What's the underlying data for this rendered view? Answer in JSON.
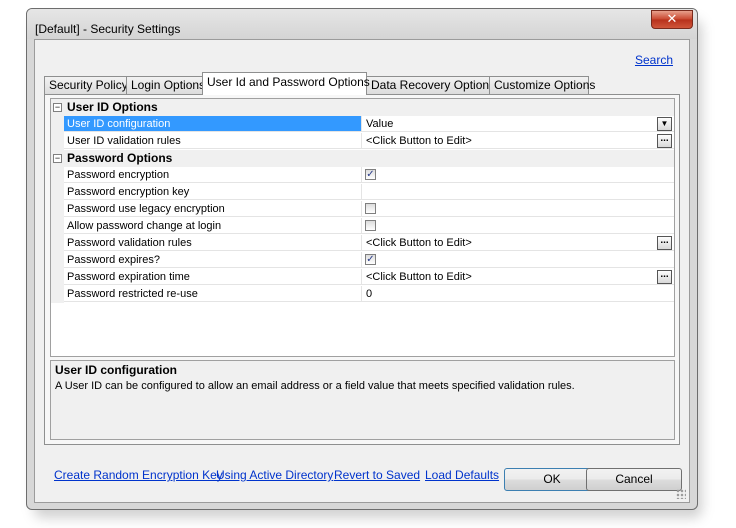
{
  "window": {
    "title": "[Default] - Security Settings",
    "close_label": "✕"
  },
  "search_link": "Search",
  "tabs": [
    {
      "label": "Security Policy",
      "active": false
    },
    {
      "label": "Login Options",
      "active": false
    },
    {
      "label": "User Id and Password Options",
      "active": true
    },
    {
      "label": "Data Recovery Options",
      "active": false
    },
    {
      "label": "Customize Options",
      "active": false
    }
  ],
  "grid": {
    "categories": [
      {
        "label": "User ID Options",
        "expander": "−",
        "rows": [
          {
            "name": "User ID configuration",
            "value": "Value",
            "editor": "dropdown",
            "selected": true
          },
          {
            "name": "User ID validation rules",
            "value": "<Click Button to Edit>",
            "editor": "ellipsis"
          }
        ]
      },
      {
        "label": "Password Options",
        "expander": "−",
        "rows": [
          {
            "name": "Password encryption",
            "checked": true,
            "editor": "checkbox"
          },
          {
            "name": "Password encryption key",
            "value": "",
            "editor": "none"
          },
          {
            "name": "Password use legacy encryption",
            "checked": false,
            "editor": "checkbox"
          },
          {
            "name": "Allow password change at login",
            "checked": false,
            "editor": "checkbox"
          },
          {
            "name": "Password validation rules",
            "value": "<Click Button to Edit>",
            "editor": "ellipsis"
          },
          {
            "name": "Password expires?",
            "checked": true,
            "editor": "checkbox"
          },
          {
            "name": "Password expiration time",
            "value": "<Click Button to Edit>",
            "editor": "ellipsis"
          },
          {
            "name": "Password restricted re-use",
            "value": "0",
            "editor": "none"
          }
        ]
      }
    ],
    "ellipsis_label": "...",
    "dropdown_label": "▼",
    "check_mark": "✓"
  },
  "description": {
    "title": "User ID configuration",
    "text": "A User ID can be configured to allow an email address or a field value that meets specified validation rules."
  },
  "footer": {
    "links": [
      "Create Random Encryption Key",
      "Using Active Directory",
      "Revert to Saved",
      "Load Defaults"
    ],
    "ok_label": "OK",
    "cancel_label": "Cancel"
  }
}
